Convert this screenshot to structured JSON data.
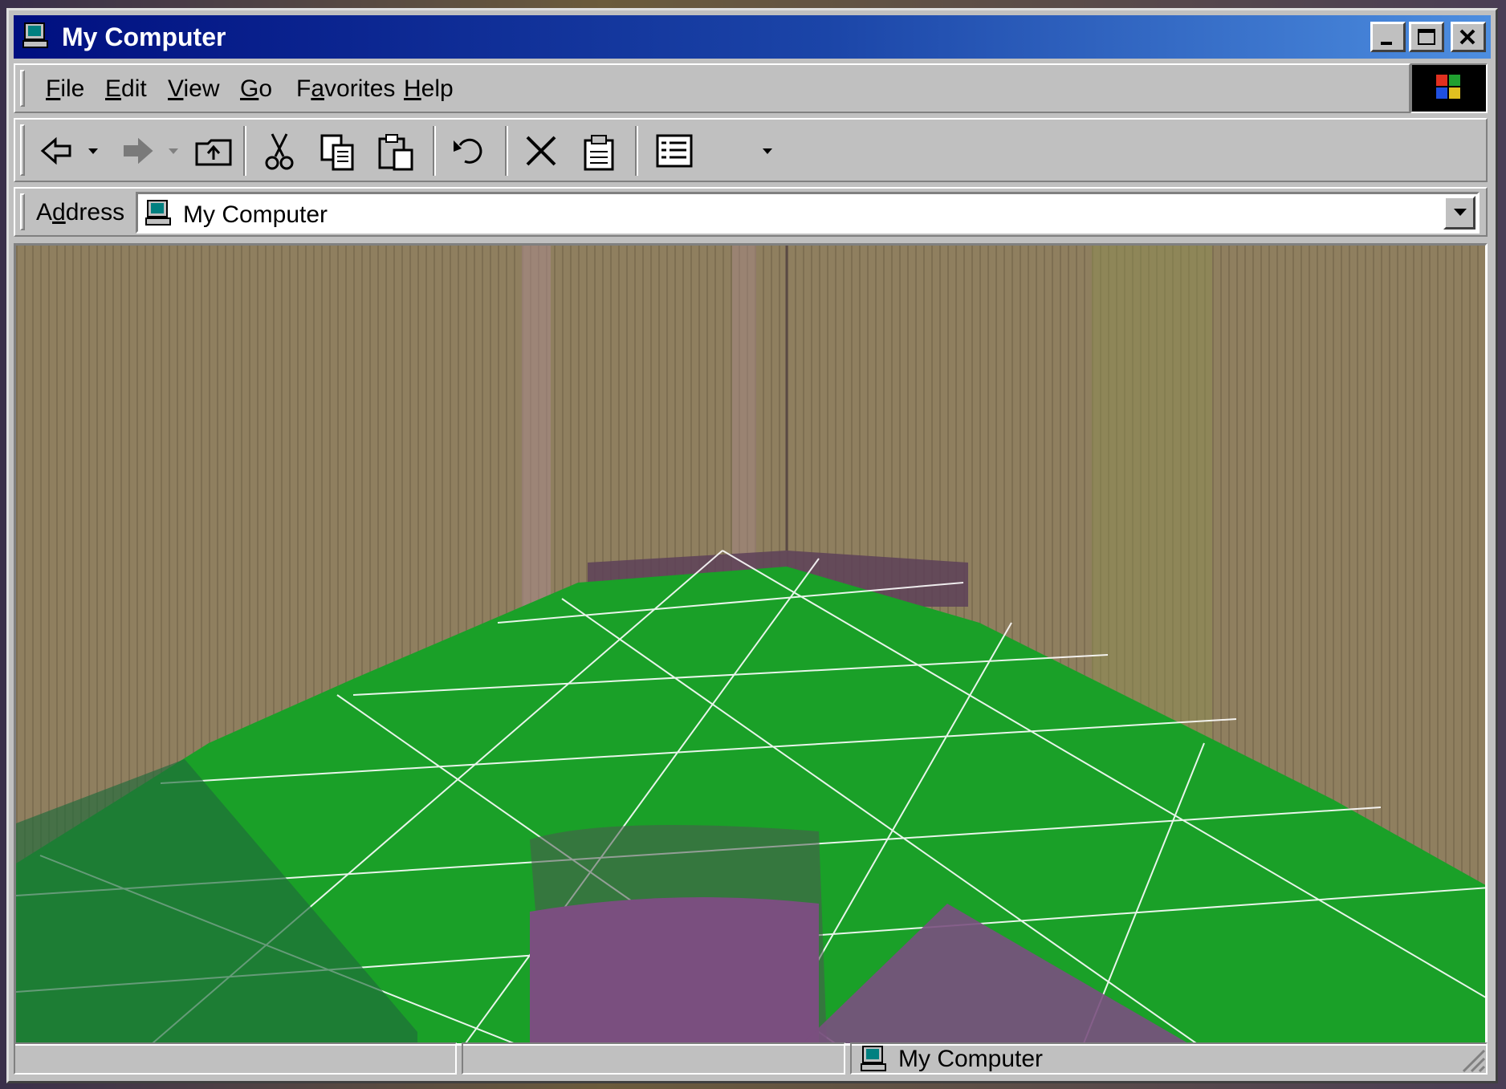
{
  "window": {
    "title": "My Computer",
    "colors": {
      "titlebar_start": "#000f80",
      "titlebar_end": "#4d8ee0",
      "face": "#c0c0c0"
    }
  },
  "menubar": {
    "items": [
      {
        "label": "File",
        "mnemonic": "F",
        "rest": "ile"
      },
      {
        "label": "Edit",
        "mnemonic": "E",
        "rest": "dit"
      },
      {
        "label": "View",
        "mnemonic": "V",
        "rest": "iew"
      },
      {
        "label": "Go",
        "mnemonic": "G",
        "rest": "o"
      },
      {
        "label": "Favorites",
        "pre": "F",
        "mnemonic": "a",
        "rest": "vorites"
      },
      {
        "label": "Help",
        "mnemonic": "H",
        "rest": "elp"
      }
    ]
  },
  "toolbar": {
    "buttons": [
      "back-icon",
      "forward-icon",
      "up-folder-icon",
      "cut-icon",
      "copy-icon",
      "paste-icon",
      "undo-icon",
      "delete-icon",
      "properties-icon",
      "views-icon"
    ]
  },
  "address": {
    "label_pre": "A",
    "label_mnemonic": "d",
    "label_rest": "dress",
    "value": "My Computer",
    "icon": "my-computer-icon"
  },
  "content": {
    "scene": "3d-room-green-wireframe-floor",
    "colors": {
      "wall": "#8f7f5f",
      "floor": "#1aa028",
      "grid": "#ffffff",
      "furniture": "#7a4f7f"
    }
  },
  "statusbar": {
    "zone_text": "My Computer",
    "zone_icon": "my-computer-icon"
  }
}
